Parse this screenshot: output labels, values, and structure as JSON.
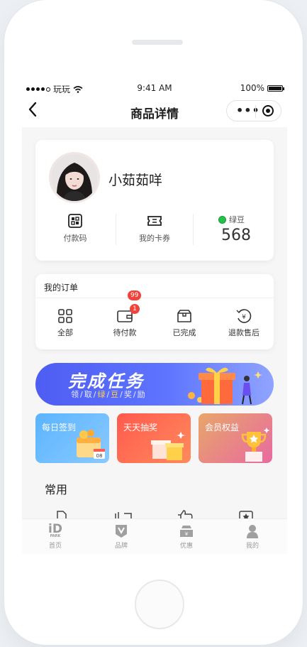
{
  "statusbar": {
    "carrier": "玩玩",
    "time": "9:41 AM",
    "battery": "100%"
  },
  "navbar": {
    "title": "商品详情"
  },
  "profile": {
    "name": "小茹茹咩",
    "pay_code": "付款码",
    "my_cards": "我的卡券",
    "beans_label": "绿豆",
    "beans_value": "568"
  },
  "orders": {
    "title": "我的订单",
    "items": [
      {
        "label": "全部",
        "icon": "grid-icon"
      },
      {
        "label": "待付款",
        "icon": "wallet-icon",
        "badge": "1",
        "badge_top": "99"
      },
      {
        "label": "已完成",
        "icon": "box-icon"
      },
      {
        "label": "退款售后",
        "icon": "refund-icon"
      }
    ]
  },
  "banner": {
    "title": "完成任务",
    "sub_parts": [
      "领",
      "取",
      "绿",
      "豆",
      "奖",
      "励"
    ]
  },
  "tiles": [
    {
      "label": "每日签到",
      "date": "08"
    },
    {
      "label": "天天抽奖"
    },
    {
      "label": "会员权益"
    }
  ],
  "section": {
    "title": "常用"
  },
  "tabbar": {
    "items": [
      {
        "label": "首页",
        "icon": "id-park-logo-icon"
      },
      {
        "label": "品牌",
        "icon": "brand-shield-icon"
      },
      {
        "label": "优惠",
        "icon": "ticket-icon"
      },
      {
        "label": "我的",
        "icon": "user-icon"
      }
    ],
    "logo_text": "iD",
    "logo_small": "PARK"
  },
  "colors": {
    "accent_blue": "#4e5df2",
    "badge_red": "#f2433b",
    "bean_green": "#25c24b"
  }
}
